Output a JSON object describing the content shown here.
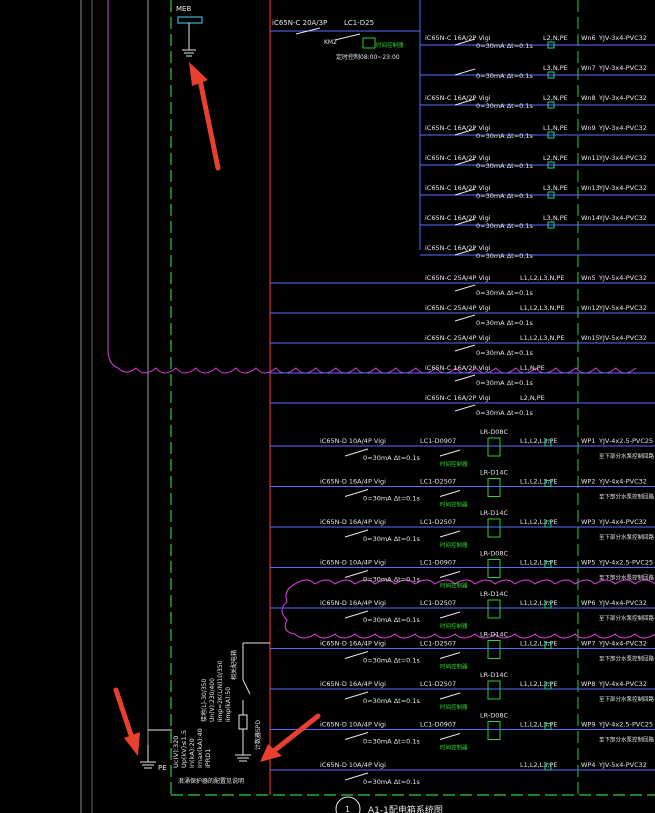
{
  "colors": {
    "background": "#000000",
    "busbar": "#e03030",
    "feeder": "#5a6cff",
    "text": "#e6e6e6",
    "dashed": "#2ecc40",
    "cloud": "#e040e0",
    "arrow": "#e8402f",
    "cable": "#1fd0a0"
  },
  "top_panel": {
    "device": "MEB",
    "incoming_breaker": "iC65N-C 20A/3P",
    "contactor_code": "LC1-D25",
    "contactor_tag": "KM2",
    "timer_label": "时间控制器",
    "timer_text": "定时控制08:00~23:00"
  },
  "upper_feeders": [
    {
      "breaker": "iC65N-C 16A/2P Vigi",
      "rcd": "0=30mA Δt=0.1s",
      "phase": "L2,N,PE",
      "circuit": "Wn6",
      "cable": "YJV-3x4-PVC32"
    },
    {
      "breaker": "",
      "rcd": "0=30mA Δt=0.1s",
      "phase": "L3,N,PE",
      "circuit": "Wn7",
      "cable": "YJV-3x4-PVC32"
    },
    {
      "breaker": "iC65N-C 16A/2P Vigi",
      "rcd": "0=30mA Δt=0.1s",
      "phase": "L2,N,PE",
      "circuit": "Wn8",
      "cable": "YJV-3x4-PVC32"
    },
    {
      "breaker": "iC65N-C 16A/2P Vigi",
      "rcd": "0=30mA Δt=0.1s",
      "phase": "L1,N,PE",
      "circuit": "Wn9",
      "cable": "YJV-3x4-PVC32"
    },
    {
      "breaker": "iC65N-C 16A/2P Vigi",
      "rcd": "0=30mA Δt=0.1s",
      "phase": "L2,N,PE",
      "circuit": "Wn11",
      "cable": "YJV-3x4-PVC32"
    },
    {
      "breaker": "iC65N-C 16A/2P Vigi",
      "rcd": "0=30mA Δt=0.1s",
      "phase": "L3,N,PE",
      "circuit": "Wn13",
      "cable": "YJV-3x4-PVC32"
    },
    {
      "breaker": "iC65N-C 16A/2P Vigi",
      "rcd": "0=30mA Δt=0.1s",
      "phase": "L3,N,PE",
      "circuit": "Wn14",
      "cable": "YJV-3x4-PVC32"
    },
    {
      "breaker": "iC65N-C 16A/2P Vigi",
      "rcd": "0=30mA Δt=0.1s",
      "phase": "",
      "circuit": "",
      "cable": ""
    }
  ],
  "mid_feeders": [
    {
      "breaker": "iC65N-C 25A/4P Vigi",
      "rcd": "0=30mA Δt=0.1s",
      "phase": "L1,L2,L3,N,PE",
      "circuit": "Wn5",
      "cable": "YJV-5x4-PVC32"
    },
    {
      "breaker": "iC65N-C 25A/4P Vigi",
      "rcd": "0=30mA Δt=0.1s",
      "phase": "L1,L2,L3,N,PE",
      "circuit": "Wn12",
      "cable": "YJV-5x4-PVC32"
    },
    {
      "breaker": "iC65N-C 25A/4P Vigi",
      "rcd": "0=30mA Δt=0.1s",
      "phase": "L1,L2,L3,N,PE",
      "circuit": "Wn15",
      "cable": "YJV-5x4-PVC32"
    },
    {
      "breaker": "iC65N-C 16A/2P Vigi",
      "rcd": "0=30mA Δt=0.1s",
      "phase": "L1,N,PE",
      "circuit": "",
      "cable": ""
    },
    {
      "breaker": "iC65N-C 16A/2P Vigi",
      "rcd": "0=30mA Δt=0.1s",
      "phase": "L2,N,PE",
      "circuit": "",
      "cable": ""
    }
  ],
  "motor_feeders": [
    {
      "breaker": "iC65N-D 10A/4P Vigi",
      "rcd": "0=30mA Δt=0.1s",
      "contactor": "LC1-D0907",
      "relay": "LR-D08C",
      "phase": "L1,L2,L3,PE",
      "circuit": "WP1",
      "cable": "YJV-4x2.5-PVC25",
      "note": "至下部分水泵控制回路"
    },
    {
      "breaker": "iC65N-D 16A/4P Vigi",
      "rcd": "0=30mA Δt=0.1s",
      "contactor": "LC1-D2507",
      "relay": "LR-D14C",
      "phase": "L1,L2,L3,PE",
      "circuit": "WP2",
      "cable": "YJV-4x4-PVC32",
      "note": "至下部分水泵控制回路"
    },
    {
      "breaker": "iC65N-D 16A/4P Vigi",
      "rcd": "0=30mA Δt=0.1s",
      "contactor": "LC1-D2507",
      "relay": "LR-D14C",
      "phase": "L1,L2,L3,PE",
      "circuit": "WP3",
      "cable": "YJV-4x4-PVC32",
      "note": "至下部分水泵控制回路"
    },
    {
      "breaker": "iC65N-D 10A/4P Vigi",
      "rcd": "0=30mA Δt=0.1s",
      "contactor": "LC1-D0907",
      "relay": "LR-D08C",
      "phase": "L1,L2,L3,PE",
      "circuit": "WP5",
      "cable": "YJV-4x2.5-PVC25",
      "note": "至下部分水泵控制回路"
    },
    {
      "breaker": "iC65N-D 16A/4P Vigi",
      "rcd": "0=30mA Δt=0.1s",
      "contactor": "LC1-D2507",
      "relay": "LR-D14C",
      "phase": "L1,L2,L3,PE",
      "circuit": "WP6",
      "cable": "YJV-4x4-PVC32",
      "note": "至下部分水泵控制回路"
    },
    {
      "breaker": "iC65N-D 16A/4P Vigi",
      "rcd": "0=30mA Δt=0.1s",
      "contactor": "LC1-D2507",
      "relay": "LR-D14C",
      "phase": "L1,L2,L3,PE",
      "circuit": "WP7",
      "cable": "YJV-4x4-PVC32",
      "note": "至下部分水泵控制回路"
    },
    {
      "breaker": "iC65N-D 16A/4P Vigi",
      "rcd": "0=30mA Δt=0.1s",
      "contactor": "LC1-D2507",
      "relay": "LR-D14C",
      "phase": "L1,L2,L3,PE",
      "circuit": "WP8",
      "cable": "YJV-4x4-PVC32",
      "note": "至下部分水泵控制回路"
    },
    {
      "breaker": "iC65N-D 10A/4P Vigi",
      "rcd": "0=30mA Δt=0.1s",
      "contactor": "LC1-D0907",
      "relay": "LR-D08C",
      "phase": "L1,L2,L3,PE",
      "circuit": "WP9",
      "cable": "YJV-4x2.5-PVC25",
      "note": "至下部分水泵控制回路"
    },
    {
      "breaker": "iC65N-D 10A/4P Vigi",
      "rcd": "0=30mA Δt=0.1s",
      "contactor": "",
      "relay": "",
      "phase": "L1,L2,L3,PE",
      "circuit": "WP4",
      "cable": "YJV-5x4-PVC32",
      "note": ""
    }
  ],
  "spd": {
    "vertical_text": [
      "Uc(V):320",
      "Up(kV)≤1.5",
      "In(kA):20",
      "Imax(kA):40",
      "iPRD1"
    ],
    "ratings": [
      "接地(L)-30/350",
      "Un(V):230/400",
      "Iimp=2K(L/N)10/350",
      "Iimp(kA):50"
    ],
    "breaker_label": "相关配电箱",
    "ground_label": "PE",
    "bottom_note": "浪涌保护器的配置见说明",
    "counter_label": "计数器SPD"
  },
  "caption": "A1-1配电箱系统图",
  "caption_mark": "1"
}
